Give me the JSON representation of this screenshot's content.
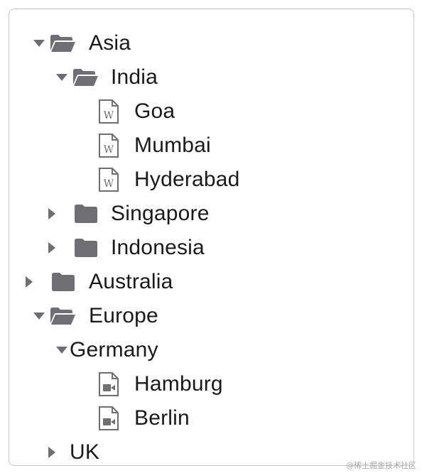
{
  "tree": {
    "asia": {
      "label": "Asia",
      "expanded": true,
      "icon": "folder-open-icon"
    },
    "india": {
      "label": "India",
      "expanded": true,
      "icon": "folder-open-icon"
    },
    "goa": {
      "label": "Goa",
      "icon": "word-document-icon"
    },
    "mumbai": {
      "label": "Mumbai",
      "icon": "word-document-icon"
    },
    "hyderabad": {
      "label": "Hyderabad",
      "icon": "word-document-icon"
    },
    "singapore": {
      "label": "Singapore",
      "expanded": false,
      "icon": "folder-closed-icon"
    },
    "indonesia": {
      "label": "Indonesia",
      "expanded": false,
      "icon": "folder-closed-icon"
    },
    "australia": {
      "label": "Australia",
      "expanded": false,
      "icon": "folder-closed-icon"
    },
    "europe": {
      "label": "Europe",
      "expanded": true,
      "icon": "folder-open-icon"
    },
    "germany": {
      "label": "Germany",
      "expanded": true
    },
    "hamburg": {
      "label": "Hamburg",
      "icon": "video-file-icon"
    },
    "berlin": {
      "label": "Berlin",
      "icon": "video-file-icon"
    },
    "uk": {
      "label": "UK",
      "expanded": false
    }
  },
  "colors": {
    "icon": "#6e6e73",
    "text": "#1a1a1a",
    "border": "#c9c9c9"
  },
  "watermark": "@稀土掘金技术社区"
}
